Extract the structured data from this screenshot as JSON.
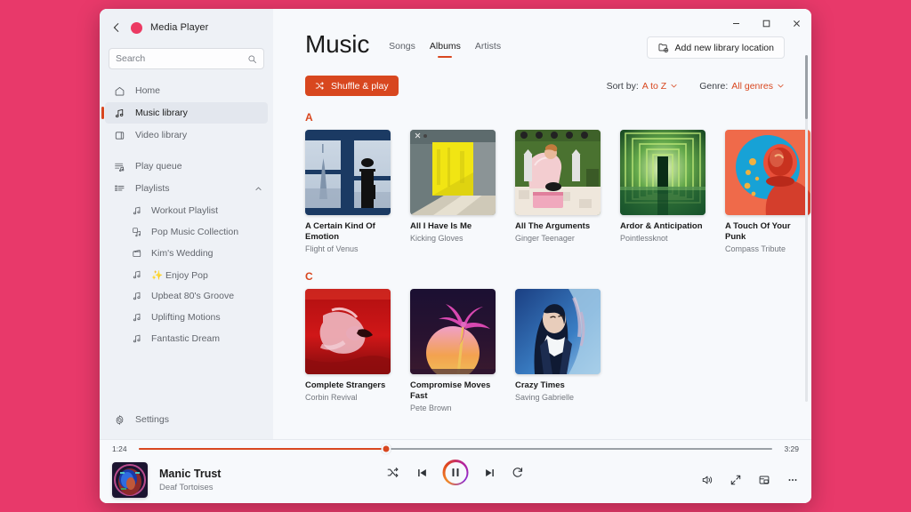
{
  "app": {
    "title": "Media Player",
    "logo_color": "#ec3a63",
    "accent": "#d8471f",
    "desktop_background": "#e8396a"
  },
  "titlebar": {
    "minimize_label": "Minimize",
    "maximize_label": "Maximize",
    "close_label": "Close"
  },
  "search": {
    "placeholder": "Search",
    "value": ""
  },
  "sidebar": {
    "items": [
      {
        "label": "Home",
        "icon": "home-icon",
        "selected": false
      },
      {
        "label": "Music library",
        "icon": "music-note-icon",
        "selected": true
      },
      {
        "label": "Video library",
        "icon": "video-icon",
        "selected": false
      },
      {
        "label": "Play queue",
        "icon": "queue-icon",
        "selected": false
      },
      {
        "label": "Playlists",
        "icon": "playlists-icon",
        "selected": false,
        "expanded": true
      }
    ],
    "playlists": [
      {
        "label": "Workout Playlist",
        "icon": "music-note-icon"
      },
      {
        "label": "Pop Music Collection",
        "icon": "music-collection-icon"
      },
      {
        "label": "Kim's Wedding",
        "icon": "film-icon"
      },
      {
        "label": "✨ Enjoy Pop",
        "icon": "music-note-icon"
      },
      {
        "label": "Upbeat 80's Groove",
        "icon": "music-note-icon"
      },
      {
        "label": "Uplifting Motions",
        "icon": "music-note-icon"
      },
      {
        "label": "Fantastic Dream",
        "icon": "music-note-icon"
      }
    ],
    "settings": {
      "label": "Settings",
      "icon": "gear-icon"
    }
  },
  "main": {
    "page_title": "Music",
    "tabs": [
      {
        "label": "Songs",
        "active": false
      },
      {
        "label": "Albums",
        "active": true
      },
      {
        "label": "Artists",
        "active": false
      }
    ],
    "add_library_button": {
      "label": "Add new library location",
      "icon": "add-folder-icon"
    },
    "shuffle_button": {
      "label": "Shuffle & play",
      "icon": "shuffle-icon"
    },
    "sort_filter": {
      "label": "Sort by:",
      "value": "A to Z"
    },
    "genre_filter": {
      "label": "Genre:",
      "value": "All genres"
    },
    "sections": [
      {
        "letter": "A",
        "albums": [
          {
            "title": "A Certain Kind Of Emotion",
            "artist": "Flight of Venus",
            "art": "art-window-city"
          },
          {
            "title": "All I Have Is Me",
            "artist": "Kicking Gloves",
            "art": "art-yellow-wall"
          },
          {
            "title": "All The Arguments",
            "artist": "Ginger Teenager",
            "art": "art-green-room"
          },
          {
            "title": "Ardor & Anticipation",
            "artist": "Pointlessknot",
            "art": "art-green-corridor"
          },
          {
            "title": "A Touch Of Your Punk",
            "artist": "Compass Tribute",
            "art": "art-astronaut-red"
          }
        ]
      },
      {
        "letter": "C",
        "albums": [
          {
            "title": "Complete Strangers",
            "artist": "Corbin Revival",
            "art": "art-red-water"
          },
          {
            "title": "Compromise Moves Fast",
            "artist": "Pete Brown",
            "art": "art-palm-sunset"
          },
          {
            "title": "Crazy Times",
            "artist": "Saving Gabrielle",
            "art": "art-blue-portrait"
          }
        ]
      }
    ]
  },
  "player": {
    "elapsed": "1:24",
    "duration": "3:29",
    "progress_percent": 39,
    "now_playing": {
      "title": "Manic Trust",
      "artist": "Deaf Tortoises",
      "art": "art-astronaut-blue"
    },
    "controls": [
      {
        "name": "shuffle-button",
        "label": "Shuffle"
      },
      {
        "name": "previous-button",
        "label": "Previous"
      },
      {
        "name": "play-pause-button",
        "label": "Pause",
        "state": "playing"
      },
      {
        "name": "next-button",
        "label": "Next"
      },
      {
        "name": "repeat-button",
        "label": "Repeat"
      }
    ],
    "right_controls": [
      {
        "name": "volume-button",
        "label": "Volume"
      },
      {
        "name": "fullscreen-button",
        "label": "Full screen"
      },
      {
        "name": "miniplayer-button",
        "label": "Mini player"
      },
      {
        "name": "more-options-button",
        "label": "More options"
      }
    ]
  }
}
